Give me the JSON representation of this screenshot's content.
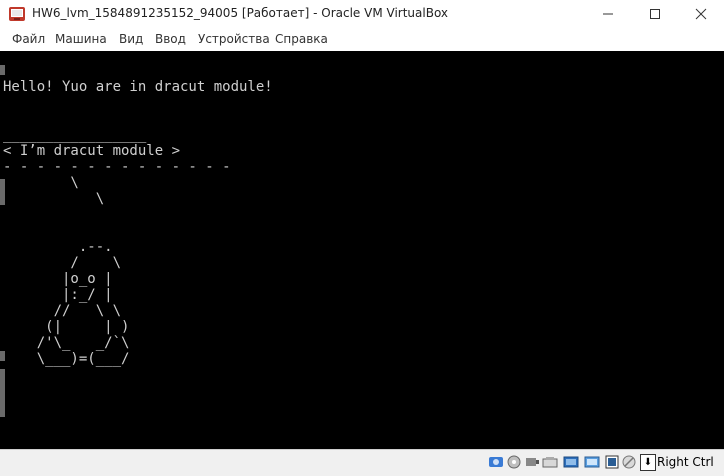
{
  "window": {
    "title": "HW6_lvm_1584891235152_94005 [Работает] - Oracle VM VirtualBox",
    "controls": {
      "minimize": "—",
      "maximize": "☐",
      "close": "✕"
    }
  },
  "menu": {
    "items": [
      "Файл",
      "Машина",
      "Вид",
      "Ввод",
      "Устройства",
      "Справка"
    ]
  },
  "console": {
    "text": "Hello! Yuo are in dracut module!\n\n\n_________________\n< I’m dracut module >\n- - - - - - - - - - - - - -\n        \\\n           \\\n\n\n         .--.\n        /    \\\n       |o_o |\n       |:_/ |\n      //   \\ \\\n     (|     | )\n    /'\\_   _/`\\\n    \\___)=(___/"
  },
  "statusbar": {
    "icons": [
      "hdd-icon",
      "optical-disc-icon",
      "audio-icon",
      "network-icon",
      "usb-icon",
      "shared-folder-icon",
      "display-icon",
      "video-capture-icon",
      "cpu-icon",
      "mouse-integration-icon"
    ],
    "host_key_arrow": "⬇",
    "host_key": "Right Ctrl"
  },
  "colors": {
    "vbox_icon": "#c0392b",
    "console_bg": "#000000",
    "console_fg": "#d0d0d0"
  }
}
